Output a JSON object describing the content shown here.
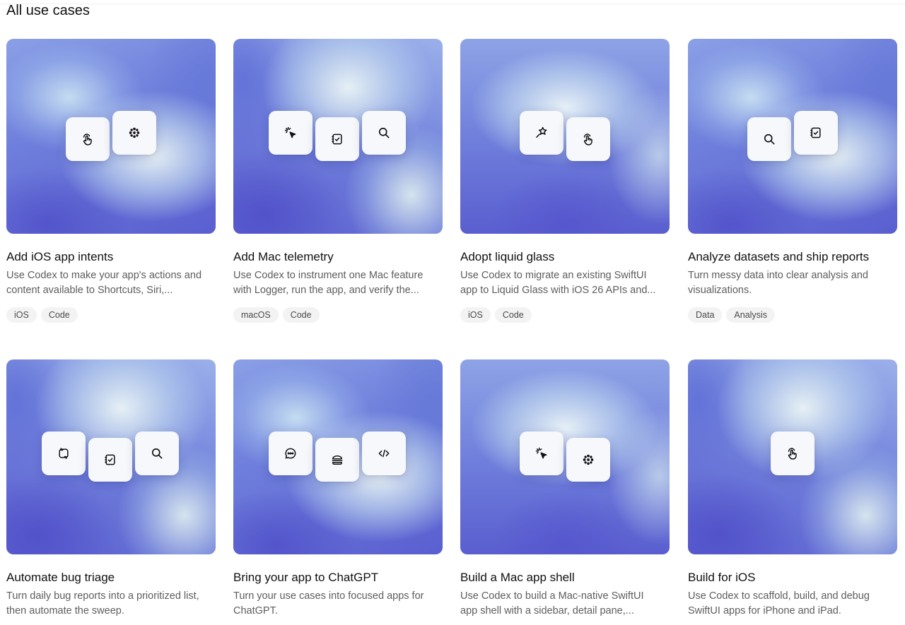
{
  "page": {
    "title": "All use cases"
  },
  "cards": [
    {
      "title": "Add iOS app intents",
      "desc": [
        "Use Codex to make your app's actions and",
        "content available to Shortcuts, Siri,..."
      ],
      "tags": [
        "iOS",
        "Code"
      ],
      "icons": [
        "tap-gesture-icon",
        "flower-icon"
      ]
    },
    {
      "title": "Add Mac telemetry",
      "desc": [
        "Use Codex to instrument one Mac feature",
        "with Logger, run the app, and verify the..."
      ],
      "tags": [
        "macOS",
        "Code"
      ],
      "icons": [
        "sparkle-cursor-icon",
        "checklist-icon",
        "search-icon"
      ]
    },
    {
      "title": "Adopt liquid glass",
      "desc": [
        "Use Codex to migrate an existing SwiftUI",
        "app to Liquid Glass with iOS 26 APIs and..."
      ],
      "tags": [
        "iOS",
        "Code"
      ],
      "icons": [
        "magic-star-icon",
        "tap-gesture-icon"
      ]
    },
    {
      "title": "Analyze datasets and ship reports",
      "desc": [
        "Turn messy data into clear analysis and",
        "visualizations."
      ],
      "tags": [
        "Data",
        "Analysis"
      ],
      "icons": [
        "search-icon",
        "checklist-icon"
      ]
    },
    {
      "title": "Automate bug triage",
      "desc": [
        "Turn daily bug reports into a prioritized list,",
        "then automate the sweep."
      ],
      "tags": [],
      "icons": [
        "rotate-square-icon",
        "checklist-icon",
        "search-icon"
      ]
    },
    {
      "title": "Bring your app to ChatGPT",
      "desc": [
        "Turn your use cases into focused apps for",
        "ChatGPT."
      ],
      "tags": [],
      "icons": [
        "chat-bubble-icon",
        "burger-icon",
        "code-icon"
      ]
    },
    {
      "title": "Build a Mac app shell",
      "desc": [
        "Use Codex to build a Mac-native SwiftUI",
        "app shell with a sidebar, detail pane,..."
      ],
      "tags": [],
      "icons": [
        "sparkle-cursor-icon",
        "flower-icon"
      ]
    },
    {
      "title": "Build for iOS",
      "desc": [
        "Use Codex to scaffold, build, and debug",
        "SwiftUI apps for iPhone and iPad."
      ],
      "tags": [],
      "icons": [
        "tap-gesture-icon"
      ]
    }
  ]
}
